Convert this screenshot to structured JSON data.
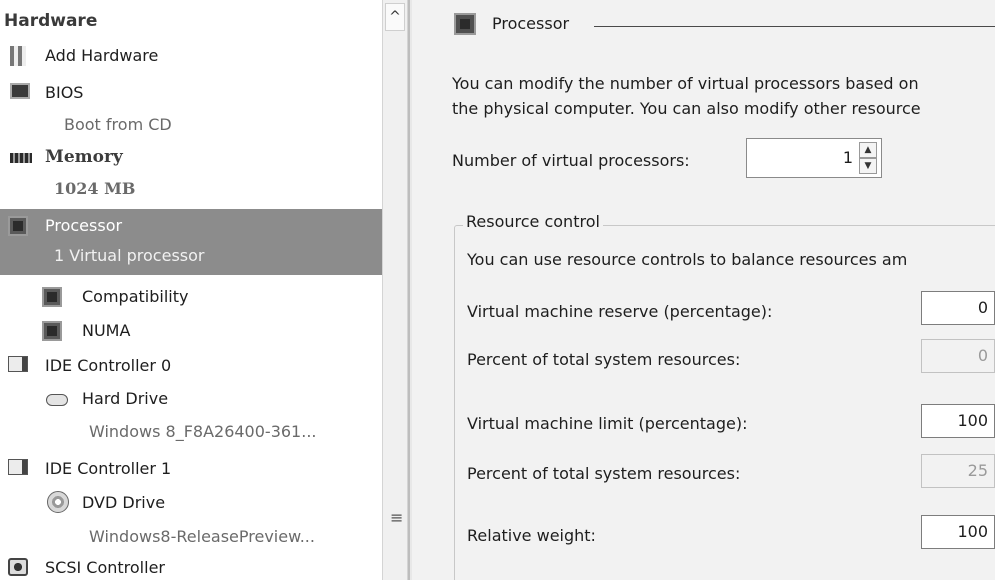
{
  "hardware": {
    "header": "Hardware",
    "items": [
      {
        "label": "Add Hardware"
      },
      {
        "label": "BIOS",
        "sub": "Boot from CD"
      },
      {
        "label": "Memory",
        "sub": "1024 MB"
      },
      {
        "label": "Processor",
        "sub": "1 Virtual processor"
      },
      {
        "label": "Compatibility"
      },
      {
        "label": "NUMA"
      },
      {
        "label": "IDE Controller 0"
      },
      {
        "label": "Hard Drive",
        "sub": "Windows 8_F8A26400-361..."
      },
      {
        "label": "IDE Controller 1"
      },
      {
        "label": "DVD Drive",
        "sub": "Windows8-ReleasePreview..."
      },
      {
        "label": "SCSI Controller"
      }
    ]
  },
  "scrollbar": {
    "up_arrow": "^",
    "grip": "≡"
  },
  "processor": {
    "title": "Processor",
    "description_line1": "You can modify the number of virtual processors based on",
    "description_line2": "the physical computer. You can also modify other resource",
    "num_processors_label": "Number of virtual processors:",
    "num_processors_value": "1",
    "spin_up": "▲",
    "spin_down": "▼"
  },
  "resource_control": {
    "title": "Resource control",
    "description": "You can use resource controls to balance resources am",
    "reserve_label": "Virtual machine reserve (percentage):",
    "reserve_value": "0",
    "reserve_total_label": "Percent of total system resources:",
    "reserve_total_value": "0",
    "limit_label": "Virtual machine limit (percentage):",
    "limit_value": "100",
    "limit_total_label": "Percent of total system resources:",
    "limit_total_value": "25",
    "weight_label": "Relative weight:",
    "weight_value": "100"
  },
  "colors": {
    "selected_bg": "#8c8c8c",
    "pane_bg": "#f2f2f2"
  }
}
